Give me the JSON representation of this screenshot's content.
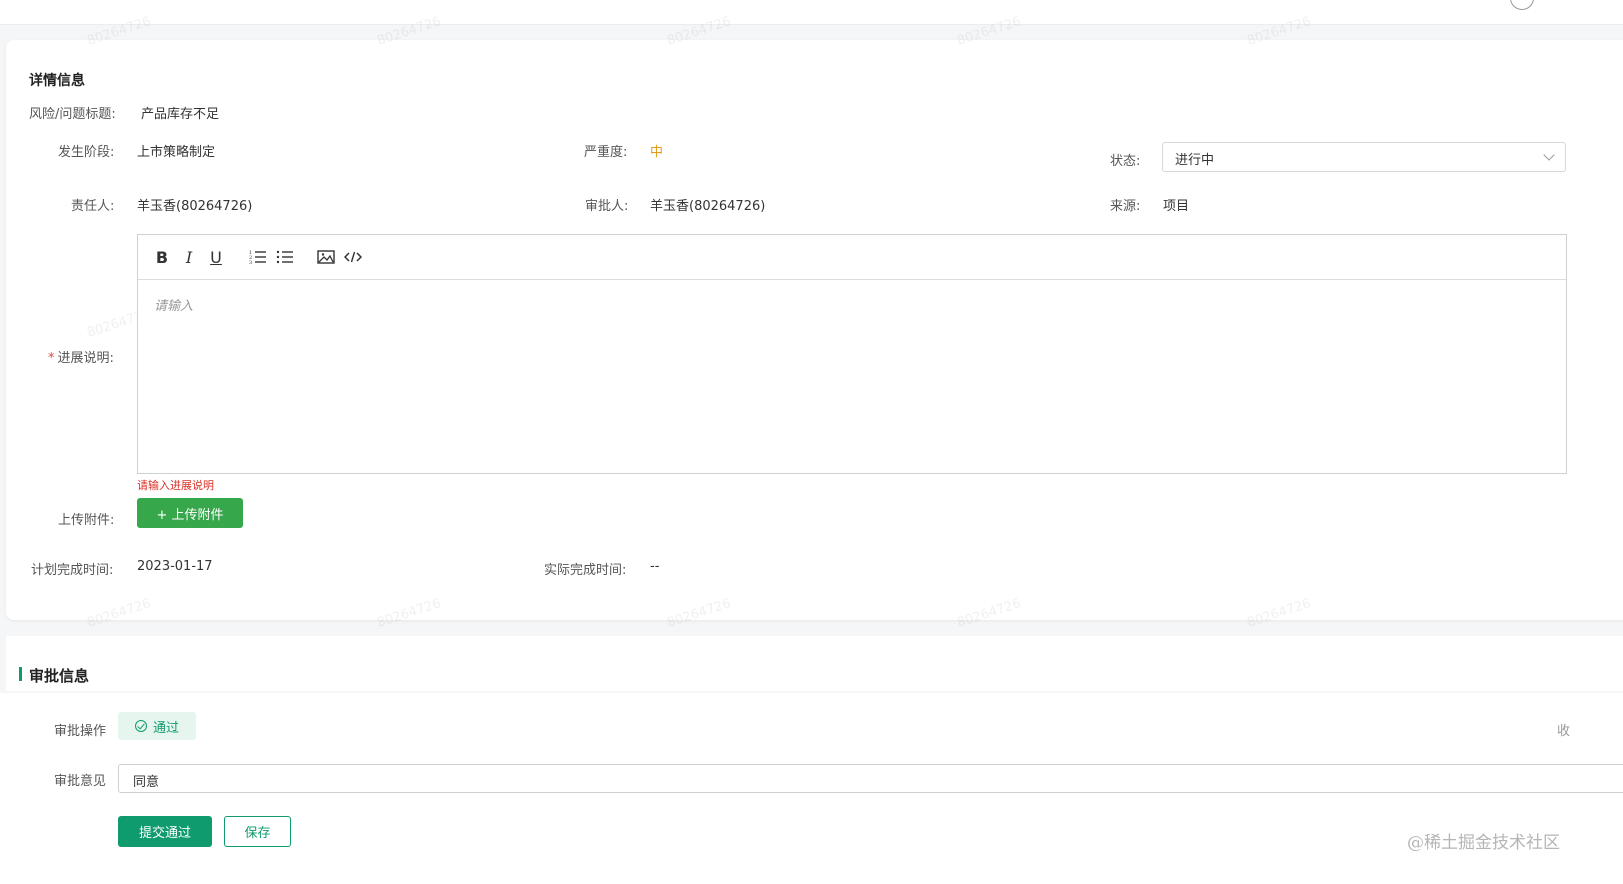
{
  "details": {
    "section_title": "详情信息",
    "risk_title_label": "风险/问题标题:",
    "risk_title_value": "产品库存不足",
    "phase_label": "发生阶段:",
    "phase_value": "上市策略制定",
    "severity_label": "严重度:",
    "severity_value": "中",
    "status_label": "状态:",
    "status_value": "进行中",
    "owner_label": "责任人:",
    "owner_value": "羊玉香(80264726)",
    "approver_label": "审批人:",
    "approver_value": "羊玉香(80264726)",
    "source_label": "来源:",
    "source_value": "项目",
    "progress_label": "进展说明:",
    "progress_required_mark": "*",
    "progress_placeholder": "请输入",
    "progress_error": "请输入进展说明",
    "upload_label": "上传附件:",
    "upload_button": "+ 上传附件",
    "planned_label": "计划完成时间:",
    "planned_value": "2023-01-17",
    "actual_label": "实际完成时间:",
    "actual_value": "--"
  },
  "toolbar": {
    "bold": "B",
    "italic": "I",
    "underline": "U"
  },
  "approval": {
    "section_title": "审批信息",
    "action_label": "审批操作",
    "action_value": "通过",
    "opinion_label": "审批意见",
    "opinion_value": "同意",
    "submit_button": "提交通过",
    "save_button": "保存",
    "right_edge_text": "收"
  },
  "watermark_text": "80264726",
  "corner_text": "@稀土掘金技术社区",
  "colors": {
    "accent": "#0f9b6e",
    "upload_button": "#37a74c",
    "severity": "#e69a1b",
    "error": "#d93026"
  }
}
